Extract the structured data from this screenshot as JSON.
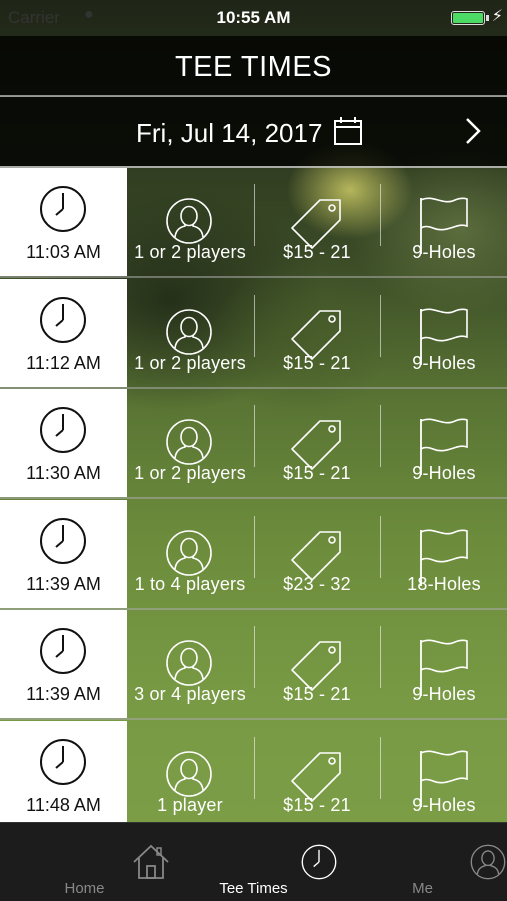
{
  "status_bar": {
    "carrier": "Carrier",
    "time": "10:55 AM"
  },
  "nav": {
    "title": "TEE TIMES"
  },
  "date_bar": {
    "date": "Fri, Jul 14, 2017"
  },
  "tee_times": [
    {
      "time": "11:03 AM",
      "players": "1 or 2 players",
      "price": "$15 - 21",
      "holes": "9-Holes"
    },
    {
      "time": "11:12 AM",
      "players": "1 or 2 players",
      "price": "$15 - 21",
      "holes": "9-Holes"
    },
    {
      "time": "11:30 AM",
      "players": "1 or 2 players",
      "price": "$15 - 21",
      "holes": "9-Holes"
    },
    {
      "time": "11:39 AM",
      "players": "1 to 4 players",
      "price": "$23 - 32",
      "holes": "18-Holes"
    },
    {
      "time": "11:39 AM",
      "players": "3 or 4 players",
      "price": "$15 - 21",
      "holes": "9-Holes"
    },
    {
      "time": "11:48 AM",
      "players": "1 player",
      "price": "$15 - 21",
      "holes": "9-Holes"
    }
  ],
  "tab_bar": {
    "items": [
      {
        "label": "Home",
        "icon": "home-icon",
        "active": false
      },
      {
        "label": "Tee Times",
        "icon": "clock-icon",
        "active": true
      },
      {
        "label": "Me",
        "icon": "person-icon",
        "active": false
      }
    ]
  },
  "colors": {
    "battery": "#4cd964",
    "time_cell_bg": "#ffffff",
    "tab_bar_bg": "#1c1c1c",
    "active_tab": "#ffffff",
    "inactive_tab": "#888888"
  }
}
